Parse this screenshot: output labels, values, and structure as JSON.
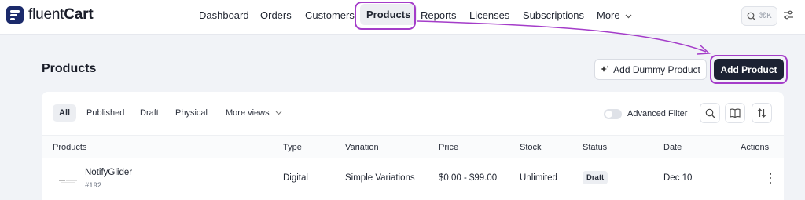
{
  "brand": {
    "prefix": "fluent",
    "suffix": "Cart"
  },
  "nav": {
    "items": [
      "Dashboard",
      "Orders",
      "Customers",
      "Products",
      "Reports",
      "Licenses",
      "Subscriptions"
    ],
    "more_label": "More",
    "active": "Products"
  },
  "search": {
    "shortcut": "⌘K"
  },
  "page": {
    "title": "Products",
    "dummy_button": "Add Dummy Product",
    "add_button": "Add Product"
  },
  "filters": {
    "tabs": [
      "All",
      "Published",
      "Draft",
      "Physical"
    ],
    "more_views": "More views",
    "advanced_filter_label": "Advanced Filter",
    "advanced_filter_on": false
  },
  "table": {
    "headers": [
      "Products",
      "Type",
      "Variation",
      "Price",
      "Stock",
      "Status",
      "Date",
      "Actions"
    ],
    "rows": [
      {
        "name": "NotifyGlider",
        "sku": "#192",
        "type": "Digital",
        "variation": "Simple Variations",
        "price": "$0.00 - $99.00",
        "stock": "Unlimited",
        "status": "Draft",
        "date": "Dec 10"
      }
    ]
  },
  "colors": {
    "brand": "#1b2a6b",
    "highlight": "#a43cc9",
    "primary_button": "#1c2233"
  },
  "icons": [
    "search-icon",
    "settings-icon",
    "sparkle-icon",
    "book-icon",
    "sort-icon",
    "chevron-down-icon",
    "kebab-menu-icon"
  ]
}
